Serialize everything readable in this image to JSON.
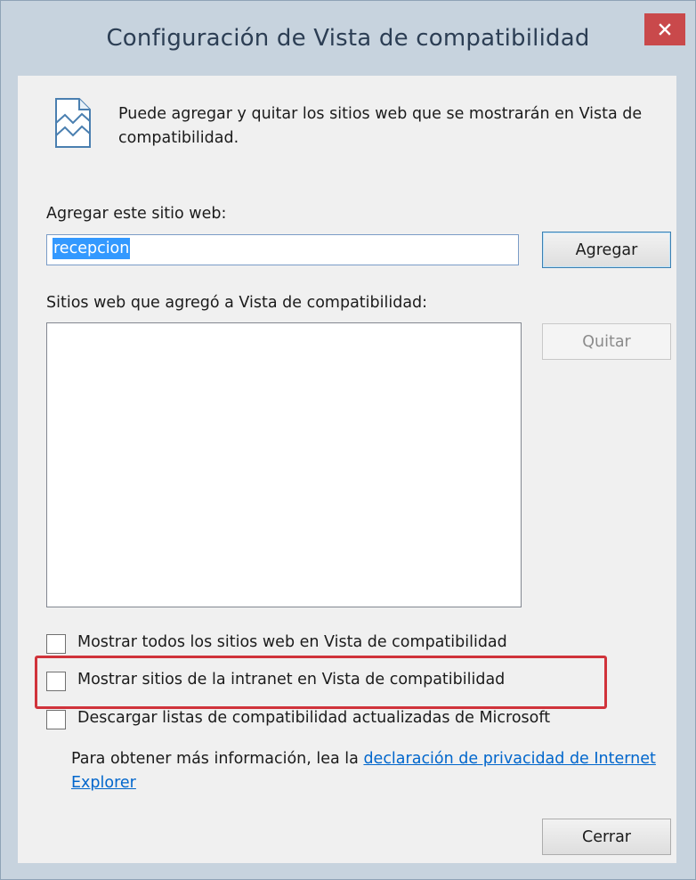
{
  "window": {
    "title": "Configuración de Vista de compatibilidad",
    "close_glyph": "✕"
  },
  "info": {
    "icon": "compatibility-view-page-icon",
    "text": "Puede agregar y quitar los sitios web que se mostrarán en Vista de compatibilidad."
  },
  "add_site": {
    "label": "Agregar este sitio web:",
    "value": "recepcion",
    "button_label": "Agregar"
  },
  "added_sites": {
    "label": "Sitios web que agregó a Vista de compatibilidad:",
    "items": [],
    "remove_button_label": "Quitar"
  },
  "options": [
    {
      "label": "Mostrar todos los sitios web en Vista de compatibilidad",
      "checked": false
    },
    {
      "label": "Mostrar sitios de la intranet en Vista de compatibilidad",
      "checked": false
    },
    {
      "label": "Descargar listas de compatibilidad actualizadas de Microsoft",
      "checked": false
    }
  ],
  "more_info": {
    "prefix": "Para obtener más información, lea la ",
    "link_text": "declaración de privacidad de Internet Explorer"
  },
  "close_button_label": "Cerrar",
  "colors": {
    "highlight": "#d0333b",
    "close_button": "#c9494b",
    "link": "#0066cc",
    "selection": "#3399ff"
  }
}
